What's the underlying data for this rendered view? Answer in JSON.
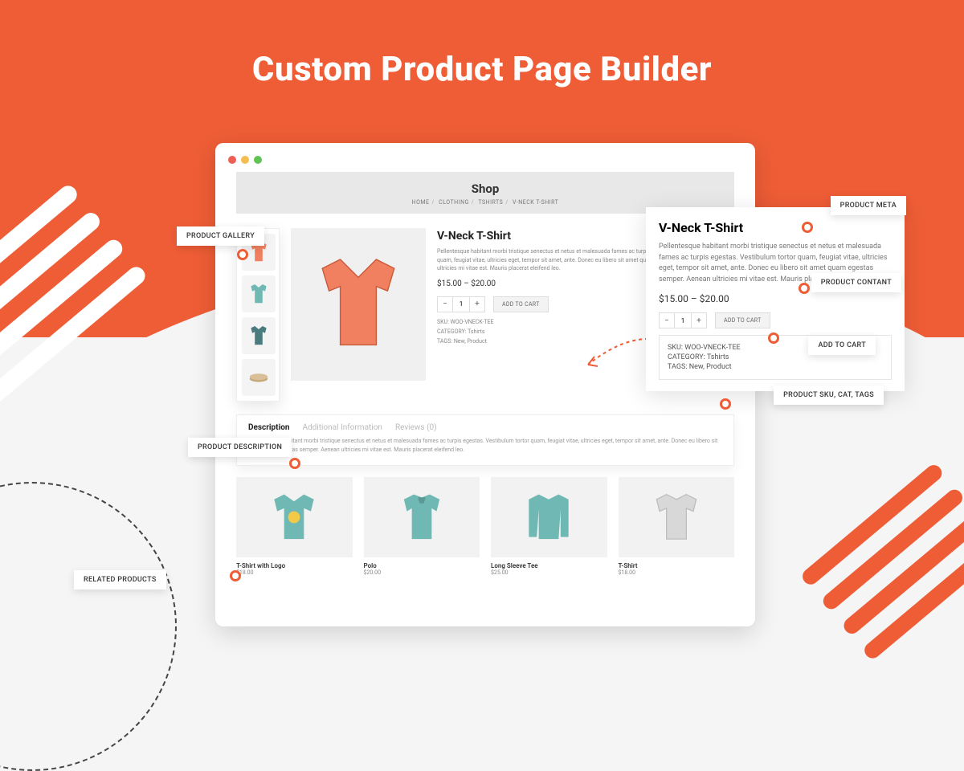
{
  "hero": {
    "title": "Custom Product Page Builder"
  },
  "shop": {
    "title": "Shop",
    "breadcrumb": [
      "HOME",
      "CLOTHING",
      "TSHIRTS",
      "V-NECK T-SHIRT"
    ]
  },
  "product": {
    "title": "V-Neck T-Shirt",
    "desc": "Pellentesque habitant morbi tristique senectus et netus et malesuada fames ac turpis egestas. Vestibulum tortor quam, feugiat vitae, ultricies eget, tempor sit amet, ante. Donec eu libero sit amet quam egestas semper. Aenean ultricies mi vitae est. Mauris placerat eleifend leo.",
    "price": "$15.00 – $20.00",
    "qty": "1",
    "add_to_cart": "ADD TO CART",
    "sku_label": "SKU:",
    "sku": "WOO-VNECK-TEE",
    "category_label": "CATEGORY:",
    "category": "Tshirts",
    "tags_label": "TAGS:",
    "tags": "New,  Product"
  },
  "side": {
    "title": "V-Neck T-Shirt",
    "desc": "Pellentesque habitant morbi tristique senectus et netus et malesuada fames ac turpis egestas. Vestibulum tortor quam, feugiat vitae, ultricies eget, tempor sit amet, ante. Donec eu libero sit amet quam egestas semper. Aenean ultricies mi vitae est. Mauris placerat eleifend.",
    "price": "$15.00 – $20.00",
    "qty": "1",
    "add_to_cart": "ADD TO CART",
    "sku": "SKU: WOO-VNECK-TEE",
    "category": "CATEGORY:   Tshirts",
    "tags": "TAGS:   New,  Product"
  },
  "tabs": {
    "description": "Description",
    "additional": "Additional Information",
    "reviews": "Reviews (0)",
    "body": "Pellentesque habitant morbi tristique senectus et netus et malesuada fames ac turpis egestas. Vestibulum tortor quam, feugiat vitae, ultricies eget, tempor sit amet, ante. Donec eu libero sit amet quam egestas semper. Aenean ultricies mi vitae est. Mauris placerat eleifend leo."
  },
  "related": [
    {
      "name": "T-Shirt with Logo",
      "price": "$18.00"
    },
    {
      "name": "Polo",
      "price": "$20.00"
    },
    {
      "name": "Long Sleeve Tee",
      "price": "$25.00"
    },
    {
      "name": "T-Shirt",
      "price": "$18.00"
    }
  ],
  "labels": {
    "gallery": "PRODUCT GALLERY",
    "meta": "PRODUCT META",
    "content": "PRODUCT CONTANT",
    "addcart": "ADD TO CART",
    "sku": "PRODUCT SKU, CAT, TAGS",
    "description": "PRODUCT DESCRIPTION",
    "related": "RELATED PRODUCTS"
  }
}
